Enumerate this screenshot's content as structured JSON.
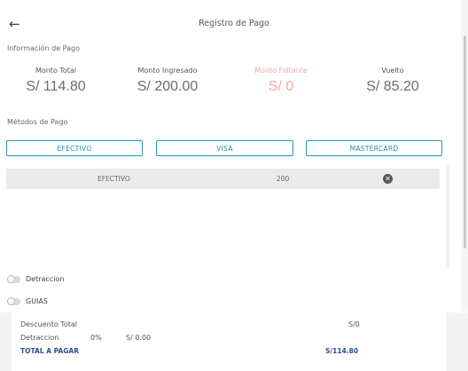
{
  "header": {
    "title": "Registro de Pago"
  },
  "payment_info": {
    "section_label": "Información de Pago",
    "metrics": [
      {
        "label": "Monto Total",
        "value": "S/ 114.80"
      },
      {
        "label": "Monto Ingresado",
        "value": "S/ 200.00"
      },
      {
        "label": "Monto Faltante",
        "value": "S/ 0"
      },
      {
        "label": "Vuelto",
        "value": "S/ 85.20"
      }
    ]
  },
  "payment_methods": {
    "section_label": "Métodos de Pago",
    "buttons": [
      "EFECTIVO",
      "VISA",
      "MASTERCARD"
    ],
    "entries": [
      {
        "method": "EFECTIVO",
        "amount": "200"
      }
    ]
  },
  "toggles": [
    {
      "label": "Detraccion",
      "on": false
    },
    {
      "label": "GUIAS",
      "on": false
    }
  ],
  "summary": {
    "discount_label": "Descuento Total",
    "discount_value": "S/0",
    "detraction_label": "Detraccion",
    "detraction_percent": "0%",
    "detraction_value": "S/ 0.00",
    "total_label": "TOTAL A PAGAR",
    "total_value": "S/114.80"
  },
  "colors": {
    "accent": "#2a9aaa",
    "missing": "#f3a9a3",
    "total": "#2e4e8f"
  }
}
